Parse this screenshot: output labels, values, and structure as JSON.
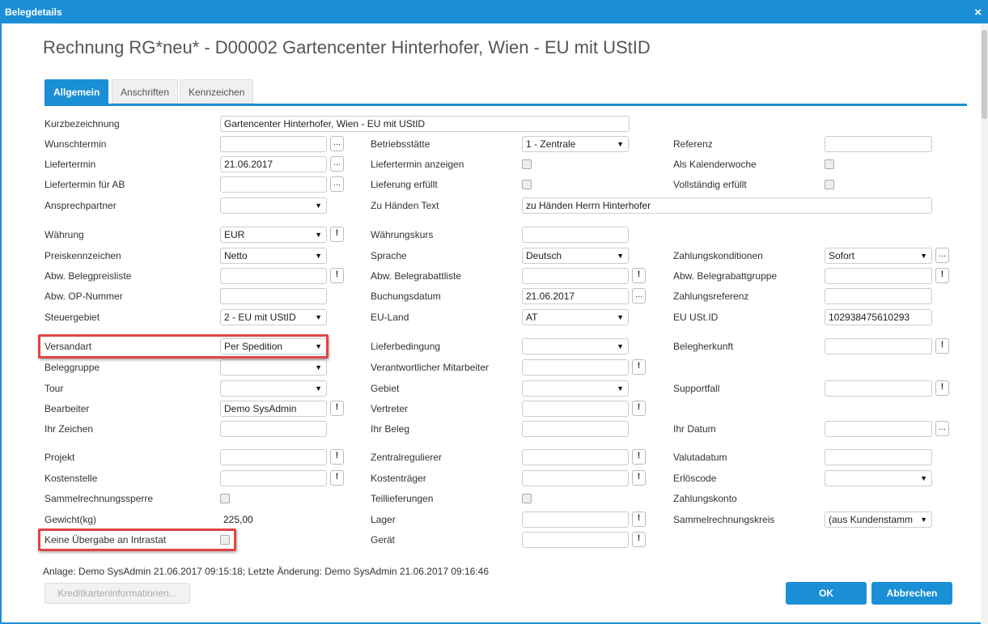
{
  "window": {
    "title": "Belegdetails",
    "close_glyph": "×"
  },
  "heading": "Rechnung RG*neu* - D00002 Gartencenter Hinterhofer, Wien - EU mit UStID",
  "tabs": {
    "allgemein": "Allgemein",
    "anschriften": "Anschriften",
    "kennzeichen": "Kennzeichen"
  },
  "labels": {
    "kurzbezeichnung": "Kurzbezeichnung",
    "wunschtermin": "Wunschtermin",
    "liefertermin": "Liefertermin",
    "liefertermin_ab": "Liefertermin für AB",
    "ansprechpartner": "Ansprechpartner",
    "waehrung": "Währung",
    "preiskennzeichen": "Preiskennzeichen",
    "abw_belegpreisliste": "Abw. Belegpreisliste",
    "abw_op_nummer": "Abw. OP-Nummer",
    "steuergebiet": "Steuergebiet",
    "versandart": "Versandart",
    "beleggruppe": "Beleggruppe",
    "tour": "Tour",
    "bearbeiter": "Bearbeiter",
    "ihr_zeichen": "Ihr Zeichen",
    "projekt": "Projekt",
    "kostenstelle": "Kostenstelle",
    "sammelrechnungssperre": "Sammelrechnungssperre",
    "gewicht": "Gewicht(kg)",
    "keine_uebergabe": "Keine Übergabe an Intrastat",
    "betriebsstaette": "Betriebsstätte",
    "liefertermin_anzeigen": "Liefertermin anzeigen",
    "lieferung_erfuellt": "Lieferung erfüllt",
    "zu_haenden": "Zu Händen Text",
    "waehrungskurs": "Währungskurs",
    "sprache": "Sprache",
    "abw_belegrabattliste": "Abw. Belegrabattliste",
    "buchungsdatum": "Buchungsdatum",
    "eu_land": "EU-Land",
    "lieferbedingung": "Lieferbedingung",
    "verantw_mitarbeiter": "Verantwortlicher Mitarbeiter",
    "gebiet": "Gebiet",
    "vertreter": "Vertreter",
    "ihr_beleg": "Ihr Beleg",
    "zentralregulierer": "Zentralregulierer",
    "kostentraeger": "Kostenträger",
    "teillieferungen": "Teillieferungen",
    "lager": "Lager",
    "geraet": "Gerät",
    "referenz": "Referenz",
    "als_kalenderwoche": "Als Kalenderwoche",
    "vollstaendig_erfuellt": "Vollständig erfüllt",
    "zahlungskonditionen": "Zahlungskonditionen",
    "abw_belegrabattgruppe": "Abw. Belegrabattgruppe",
    "zahlungsreferenz": "Zahlungsreferenz",
    "eu_ustid": "EU USt.ID",
    "belegherkunft": "Belegherkunft",
    "supportfall": "Supportfall",
    "ihr_datum": "Ihr Datum",
    "valutadatum": "Valutadatum",
    "erloescode": "Erlöscode",
    "zahlungskonto": "Zahlungskonto",
    "sammelrechnungskreis": "Sammelrechnungskreis"
  },
  "values": {
    "kurzbezeichnung": "Gartencenter Hinterhofer, Wien - EU mit UStID",
    "liefertermin": "21.06.2017",
    "waehrung": "EUR",
    "preiskennzeichen": "Netto",
    "steuergebiet": "2 - EU mit UStID",
    "versandart": "Per Spedition",
    "bearbeiter": "Demo SysAdmin",
    "gewicht": "225,00",
    "betriebsstaette": "1 - Zentrale",
    "zu_haenden": "zu Händen Herrn Hinterhofer",
    "sprache": "Deutsch",
    "buchungsdatum": "21.06.2017",
    "eu_land": "AT",
    "zahlungskonditionen": "Sofort",
    "eu_ustid": "102938475610293",
    "sammelrechnungskreis": "(aus Kundenstamm"
  },
  "glyphs": {
    "dots": "...",
    "excl": "!",
    "arrow": "▼"
  },
  "footer": {
    "info": "Anlage: Demo SysAdmin 21.06.2017 09:15:18; Letzte Änderung: Demo SysAdmin 21.06.2017 09:16:46",
    "kreditkarten": "Kreditkarteninformationen...",
    "ok": "OK",
    "abbrechen": "Abbrechen"
  },
  "colors": {
    "accent": "#1a8fd6",
    "highlight": "#e04444"
  }
}
